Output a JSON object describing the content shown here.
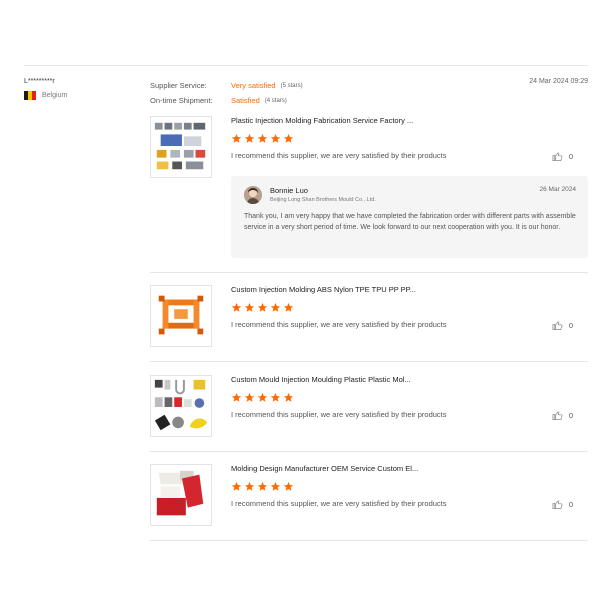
{
  "reviewer": {
    "name": "L*********r",
    "country": "Belgium",
    "flag_colors": [
      "#1a1a1a",
      "#f5c400",
      "#e2231a"
    ]
  },
  "ratings": {
    "supplier_service_label": "Supplier Service:",
    "supplier_service_value": "Very satisfied",
    "supplier_service_stars": "(5 stars)",
    "shipment_label": "On-time Shipment:",
    "shipment_value": "Satisfied",
    "shipment_stars": "(4 stars)",
    "date": "24 Mar 2024 09:29"
  },
  "accent_color": "#ff6a00",
  "items": [
    {
      "title": "Plastic Injection Molding Fabrication Service Factory ...",
      "rating": 5,
      "text": "I recommend this supplier, we are very satisfied by their products",
      "likes": "0",
      "image_icon": "molding-machines-image"
    },
    {
      "title": "Custom Injection Molding ABS Nylon TPE TPU PP PP...",
      "rating": 5,
      "text": "I recommend this supplier, we are very satisfied by their products",
      "likes": "0",
      "image_icon": "orange-plastic-part-image"
    },
    {
      "title": "Custom Mould Injection Moulding Plastic Plastic Mol...",
      "rating": 5,
      "text": "I recommend this supplier, we are very satisfied by their products",
      "likes": "0",
      "image_icon": "assorted-plastic-parts-image"
    },
    {
      "title": "Molding Design Manufacturer OEM Service Custom El...",
      "rating": 5,
      "text": "I recommend this supplier, we are very satisfied by their products",
      "likes": "0",
      "image_icon": "red-white-parts-image"
    }
  ],
  "reply": {
    "name": "Bonnie Luo",
    "company": "Beijing Long Shan Brothers Mould Co., Ltd.",
    "date": "26 Mar 2024",
    "text": "Thank you, I am very happy that we have completed the fabrication order  with different parts with assemble service in a very short period of time. We look forward to our next cooperation with you. It is our honor."
  }
}
